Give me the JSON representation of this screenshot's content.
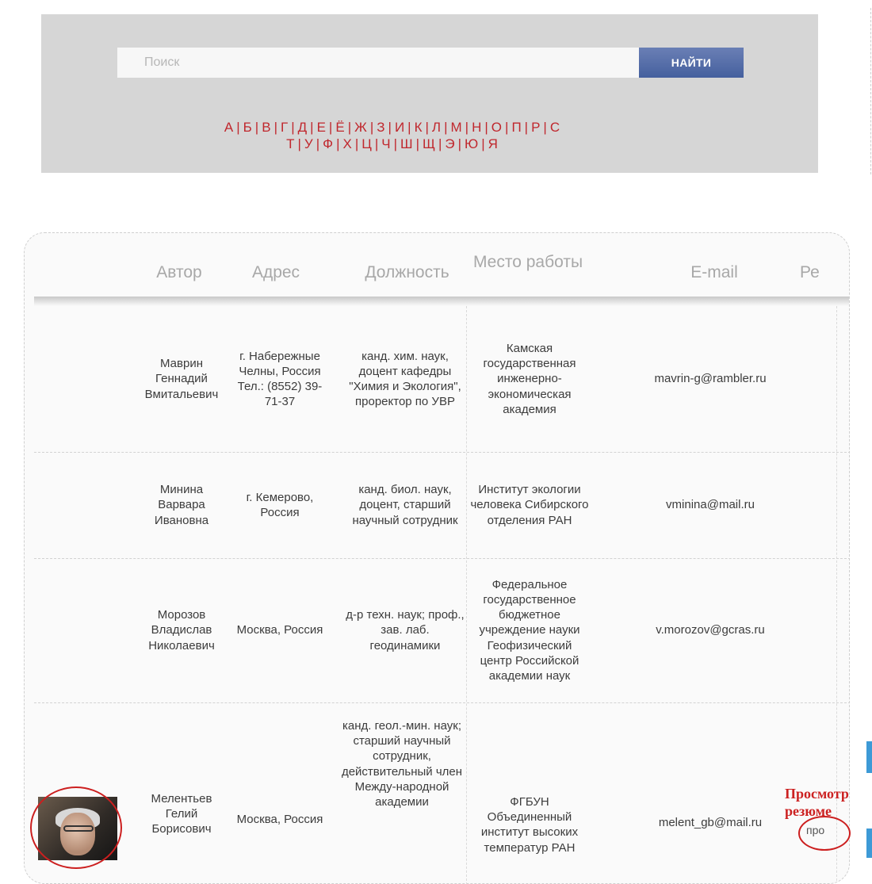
{
  "search": {
    "placeholder": "Поиск",
    "button_label": "НАЙТИ"
  },
  "alphabet": {
    "row1": [
      "А",
      "Б",
      "В",
      "Г",
      "Д",
      "Е",
      "Ё",
      "Ж",
      "З",
      "И",
      "К",
      "Л",
      "М",
      "Н",
      "О",
      "П",
      "Р",
      "С"
    ],
    "row2": [
      "Т",
      "У",
      "Ф",
      "Х",
      "Ц",
      "Ч",
      "Ш",
      "Щ",
      "Э",
      "Ю",
      "Я"
    ]
  },
  "table": {
    "headers": [
      "Автор",
      "Адрес",
      "Должность",
      "Место работы",
      "E-mail",
      "Ре"
    ],
    "rows": [
      {
        "author": "Маврин Геннадий Вмитальевич",
        "address": "г. Набережные Челны, Россия Тел.: (8552) 39-71-37",
        "position": "канд. хим. наук, доцент кафедры \"Химия и Экология\", проректор по УВР",
        "workplace": "Камская государственная инженерно-экономическая академия",
        "email": "mavrin-g@rambler.ru"
      },
      {
        "author": "Минина Варвара Ивановна",
        "address": "г. Кемерово, Россия",
        "position": "канд. биол. наук, доцент, старший научный сотрудник",
        "workplace": "Институт экологии человека Сибирского отделения РАН",
        "email": "vminina@mail.ru"
      },
      {
        "author": "Морозов Владислав Николаевич",
        "address": "Москва, Россия",
        "position": "д-р техн. наук; проф., зав. лаб. геодинамики",
        "workplace": "Федеральное государственное бюджетное учреждение науки Геофизический центр Российской академии наук",
        "email": "v.morozov@gcras.ru"
      },
      {
        "author": "Мелентьев Гелий Борисович",
        "address": "Москва, Россия",
        "position": "канд. геол.-мин. наук; старший научный сотрудник, действительный член Между-народной академии",
        "workplace": "ФГБУН Объединенный институт высоких температур РАН",
        "email": "melent_gb@mail.ru",
        "resume_link": "про"
      }
    ]
  },
  "annotation": {
    "line1": "Просмотр",
    "line2": "резюме"
  },
  "colors": {
    "accent_red": "#c0272d",
    "button_blue": "#4f68a8",
    "annotation_red": "#cc1f1f"
  }
}
